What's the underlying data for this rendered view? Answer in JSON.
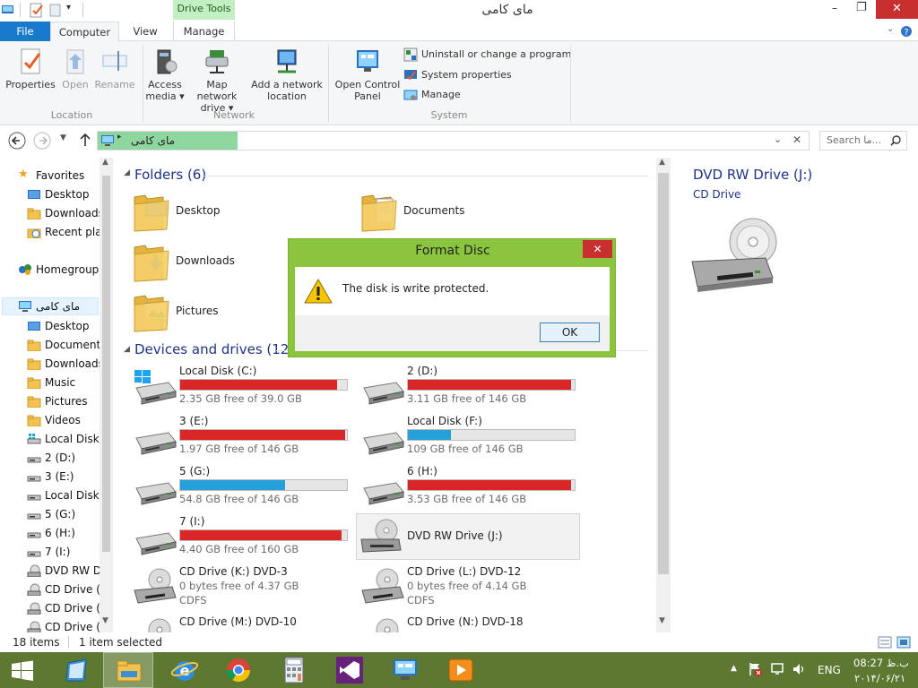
{
  "window": {
    "title": "ماى كامى",
    "contextual_tab": "Drive Tools",
    "controls": {
      "minimize": "–",
      "restore": "❐",
      "close": "✕"
    }
  },
  "tabs": {
    "file": "File",
    "computer": "Computer",
    "view": "View",
    "manage": "Manage"
  },
  "ribbon": {
    "location": {
      "group": "Location",
      "properties": "Properties",
      "open": "Open",
      "rename": "Rename"
    },
    "network": {
      "group": "Network",
      "access_media_1": "Access",
      "access_media_2": "media ▾",
      "map_drive_1": "Map network",
      "map_drive_2": "drive ▾",
      "add_loc_1": "Add a network",
      "add_loc_2": "location"
    },
    "system": {
      "group": "System",
      "control_panel_1": "Open Control",
      "control_panel_2": "Panel",
      "uninstall": "Uninstall or change a program",
      "system_properties": "System properties",
      "manage": "Manage"
    }
  },
  "address": {
    "path": "ماى كامى",
    "search_placeholder": "Search ما..."
  },
  "nav": {
    "favorites": "Favorites",
    "fav_items": [
      "Desktop",
      "Downloads",
      "Recent places"
    ],
    "homegroup": "Homegroup",
    "computer": "ماى كامى",
    "computer_items": [
      "Desktop",
      "Documents",
      "Downloads",
      "Music",
      "Pictures",
      "Videos",
      "Local Disk (C:)",
      "2 (D:)",
      "3 (E:)",
      "Local Disk (F:)",
      "5 (G:)",
      "6 (H:)",
      "7 (I:)",
      "DVD RW Drive (J:)",
      "CD Drive (K:)",
      "CD Drive (L:)",
      "CD Drive (M:)"
    ]
  },
  "content": {
    "folders_header": "Folders (6)",
    "folders": [
      "Desktop",
      "Documents",
      "Downloads",
      "Pictures"
    ],
    "devices_header": "Devices and drives (12)",
    "drives": [
      {
        "name": "Local Disk (C:)",
        "free": "2.35 GB free of 39.0 GB",
        "used_fraction": 0.94,
        "critical": true
      },
      {
        "name": "2 (D:)",
        "free": "3.11 GB free of 146 GB",
        "used_fraction": 0.98,
        "critical": true
      },
      {
        "name": "3 (E:)",
        "free": "1.97 GB free of 146 GB",
        "used_fraction": 0.99,
        "critical": true
      },
      {
        "name": "Local Disk (F:)",
        "free": "109 GB free of 146 GB",
        "used_fraction": 0.26,
        "critical": false
      },
      {
        "name": "5 (G:)",
        "free": "54.8 GB free of 146 GB",
        "used_fraction": 0.63,
        "critical": false
      },
      {
        "name": "6 (H:)",
        "free": "3.53 GB free of 146 GB",
        "used_fraction": 0.98,
        "critical": true
      },
      {
        "name": "7 (I:)",
        "free": "4.40 GB free of 160 GB",
        "used_fraction": 0.97,
        "critical": true
      }
    ],
    "dvd": {
      "name": "DVD RW Drive (J:)"
    },
    "cd_drives": [
      {
        "name": "CD Drive (K:) DVD-3",
        "free": "0 bytes free of 4.37 GB",
        "fs": "CDFS"
      },
      {
        "name": "CD Drive (L:) DVD-12",
        "free": "0 bytes free of 4.14 GB",
        "fs": "CDFS"
      },
      {
        "name": "CD Drive (M:) DVD-10"
      },
      {
        "name": "CD Drive (N:) DVD-18"
      }
    ]
  },
  "preview": {
    "title": "DVD RW Drive (J:)",
    "subtitle": "CD Drive"
  },
  "status": {
    "items": "18 items",
    "selected": "1 item selected"
  },
  "dialog": {
    "title": "Format Disc",
    "message": "The disk is write protected.",
    "ok": "OK",
    "close": "✕"
  },
  "taskbar": {
    "lang": "ENG",
    "time": "08:27 ب.ظ",
    "date": "۲۰۱۴/۰۶/۲۱"
  },
  "colors": {
    "critical_bar": "#da2626",
    "normal_bar": "#26a0da",
    "accent": "#1979ca",
    "taskbar": "#5d7830",
    "dialog_frame": "#8bc53f"
  }
}
